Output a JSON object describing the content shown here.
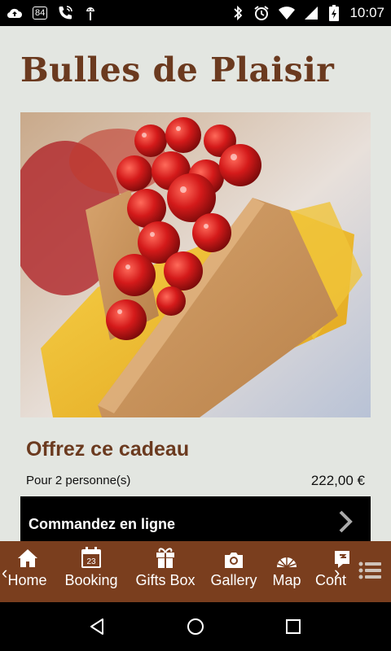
{
  "status_bar": {
    "sim_badge": "84",
    "time": "10:07",
    "icons": [
      "cloud-upload-icon",
      "sim-card-icon",
      "phone-call-icon",
      "android-debug-icon",
      "bluetooth-icon",
      "alarm-icon",
      "wifi-icon",
      "signal-icon",
      "battery-charging-icon"
    ]
  },
  "page": {
    "title": "Bulles de Plaisir",
    "offer_title": "Offrez ce cadeau",
    "persons": "Pour 2 personne(s)",
    "price": "222,00 €",
    "order_label": "Commandez en ligne"
  },
  "tabbar": {
    "tabs": [
      {
        "label": "Home",
        "icon": "home-icon"
      },
      {
        "label": "Booking",
        "icon": "calendar-icon",
        "icon_text": "23"
      },
      {
        "label": "Gifts Box",
        "icon": "gift-icon"
      },
      {
        "label": "Gallery",
        "icon": "camera-icon"
      },
      {
        "label": "Map",
        "icon": "map-icon"
      },
      {
        "label": "Cont",
        "icon": "contact-icon"
      }
    ],
    "accent": "#7a3e1e"
  },
  "colors": {
    "title_brown": "#6b3a1f",
    "background": "#e3e6e1"
  }
}
